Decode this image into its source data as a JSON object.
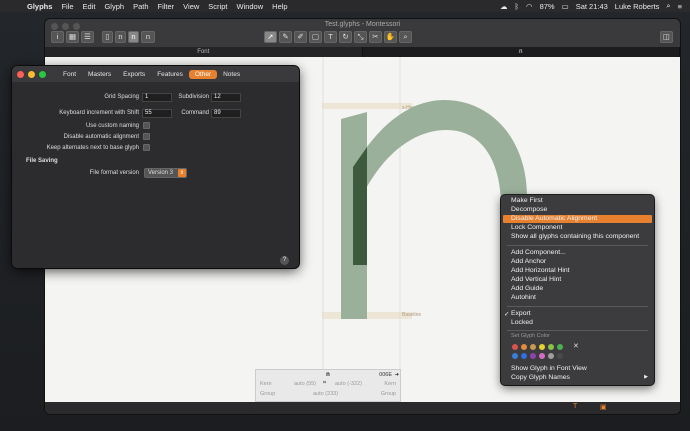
{
  "menubar": {
    "app": "Glyphs",
    "items": [
      "File",
      "Edit",
      "Glyph",
      "Path",
      "Filter",
      "View",
      "Script",
      "Window",
      "Help"
    ],
    "battery": "87%",
    "clock": "Sat 21:43",
    "user": "Luke Roberts"
  },
  "document": {
    "title": "Test.glyphs - Montessori",
    "tabs": [
      "Font",
      "n"
    ],
    "toolbar_glyphs": [
      "n",
      "n",
      "n"
    ]
  },
  "canvas": {
    "xheight_label": "x-Height",
    "baseline_label": "Baseline"
  },
  "glyph_info": {
    "name": "n",
    "unicode": "006E",
    "kern_label": "Kern",
    "kern_left": "auto (55)",
    "kern_right": "auto (-322)",
    "kern_label2": "Kern",
    "group_label": "Group",
    "group_value": "auto (233)",
    "group_label2": "Group"
  },
  "prefs": {
    "tabs": [
      "Font",
      "Masters",
      "Exports",
      "Features",
      "Other",
      "Notes"
    ],
    "grid_spacing_label": "Grid Spacing",
    "grid_spacing": "1",
    "subdivision_label": "Subdivision",
    "subdivision": "12",
    "kbd_increment_label": "Keyboard increment with Shift",
    "kbd_increment": "55",
    "command_label": "Command",
    "command": "89",
    "custom_naming_label": "Use custom naming",
    "disable_align_label": "Disable automatic alignment",
    "keep_alternates_label": "Keep alternates next to base glyph",
    "file_saving_heading": "File Saving",
    "file_format_label": "File format version",
    "file_format_value": "Version 3",
    "help": "?"
  },
  "context_menu": {
    "group1": [
      "Make First",
      "Decompose",
      "Disable Automatic Alignment",
      "Lock Component",
      "Show all glyphs containing this component"
    ],
    "group2": [
      "Add Component...",
      "Add Anchor",
      "Add Horizontal Hint",
      "Add Vertical Hint",
      "Add Guide",
      "Autohint"
    ],
    "group3": [
      "Export",
      "Locked"
    ],
    "export_check": "✓",
    "set_color_label": "Set Glyph Color",
    "clear_color": "✕",
    "group4": [
      "Show Glyph in Font View",
      "Copy Glyph Names"
    ],
    "submenu_arrow": "▶",
    "colors_row1": [
      "#d9534f",
      "#e38b3b",
      "#c79a52",
      "#e6d32e",
      "#8bc34a",
      "#4caf50"
    ],
    "colors_row2": [
      "#3b7dd8",
      "#2f6fe0",
      "#8e44ad",
      "#d46bc9",
      "#9e9e9e",
      "#4a4a4a"
    ]
  },
  "colors": {
    "accent": "#e8812f",
    "glyph_fill": "#9bb09b",
    "glyph_dark": "#3e5a3e"
  }
}
